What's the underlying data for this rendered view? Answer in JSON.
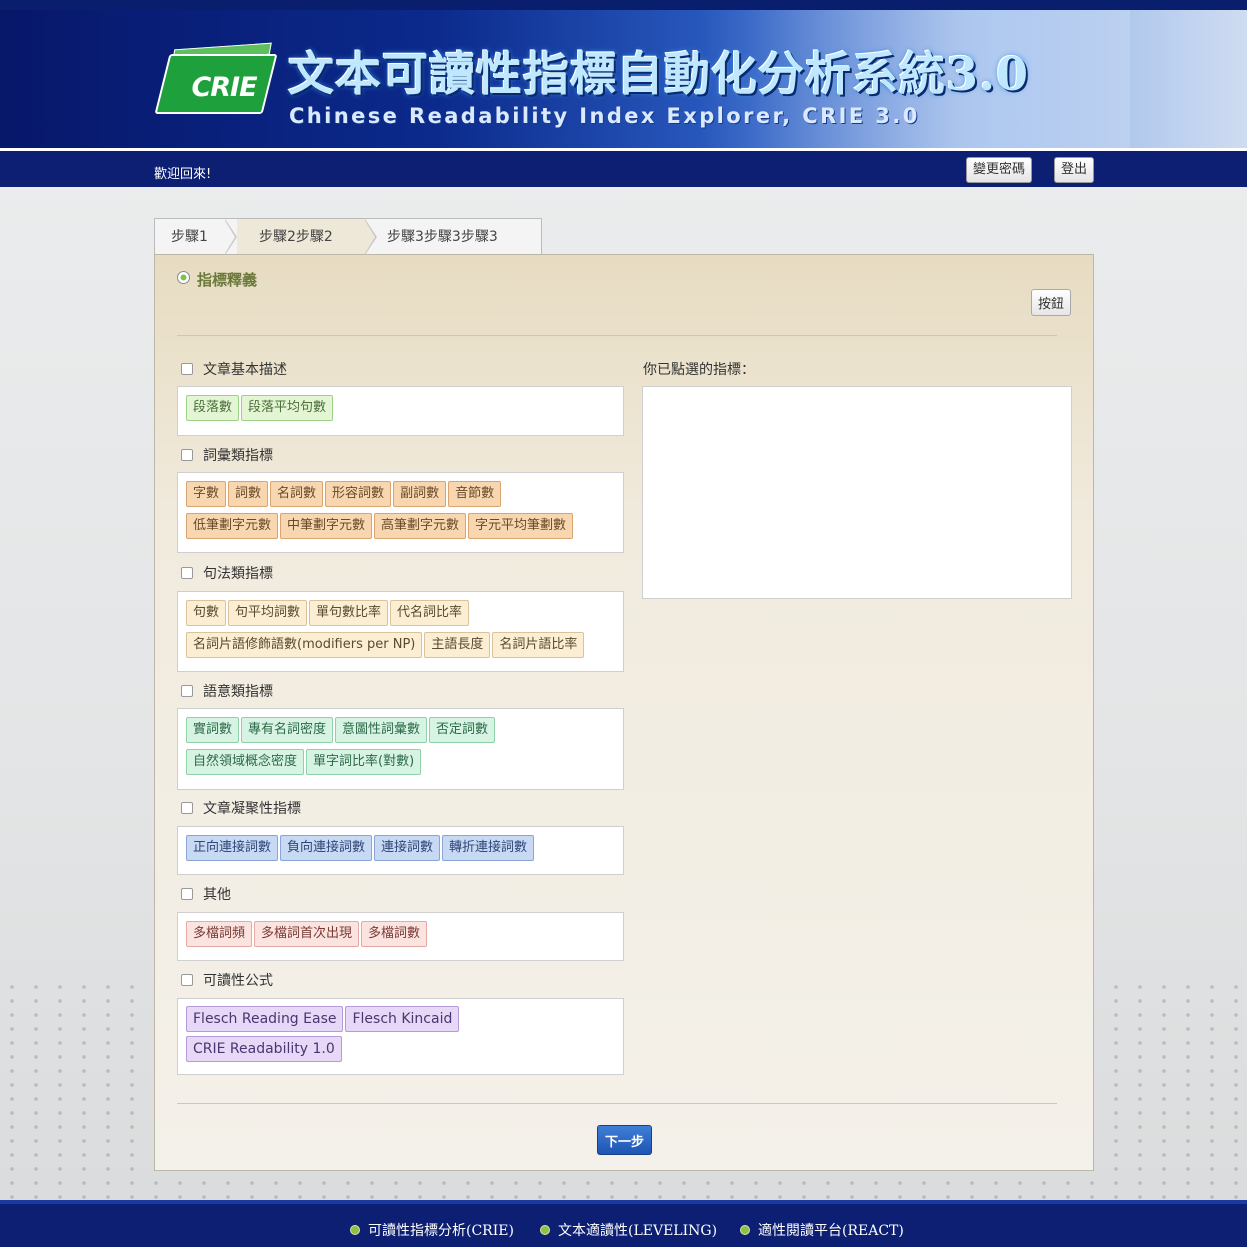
{
  "banner": {
    "logo_text": "CRIE",
    "title_zh": "文本可讀性指標自動化分析系統3.0",
    "title_en": "Chinese Readability Index Explorer, CRIE 3.0"
  },
  "navbar": {
    "welcome": "歡迎回來!",
    "change_password": "變更密碼",
    "logout": "登出"
  },
  "steps": [
    {
      "label": "步驟1"
    },
    {
      "label": "步驟2步驟2"
    },
    {
      "label": "步驟3步驟3步驟3"
    }
  ],
  "panel": {
    "title": "指標釋義",
    "button": "按鈕",
    "selected_label": "你已點選的指標：",
    "next": "下一步"
  },
  "categories": {
    "basic": {
      "title": "文章基本描述",
      "tags": [
        "段落數",
        "段落平均句數"
      ]
    },
    "vocab": {
      "title": "詞彙類指標",
      "tags": [
        "字數",
        "詞數",
        "名詞數",
        "形容詞數",
        "副詞數",
        "音節數",
        "低筆劃字元數",
        "中筆劃字元數",
        "高筆劃字元數",
        "字元平均筆劃數"
      ]
    },
    "syntax": {
      "title": "句法類指標",
      "tags": [
        "句數",
        "句平均詞數",
        "單句數比率",
        "代名詞比率",
        "名詞片語修飾語數(modifiers per NP)",
        "主語長度",
        "名詞片語比率"
      ]
    },
    "semantic": {
      "title": "語意類指標",
      "tags": [
        "實詞數",
        "專有名詞密度",
        "意圖性詞彙數",
        "否定詞數",
        "自然領域概念密度",
        "單字詞比率(對數)"
      ]
    },
    "cohesion": {
      "title": "文章凝聚性指標",
      "tags": [
        "正向連接詞數",
        "負向連接詞數",
        "連接詞數",
        "轉折連接詞數"
      ]
    },
    "other": {
      "title": "其他",
      "tags": [
        "多檔詞頻",
        "多檔詞首次出現",
        "多檔詞數"
      ]
    },
    "formula": {
      "title": "可讀性公式",
      "tags": [
        "Flesch Reading Ease",
        "Flesch Kincaid",
        "CRIE Readability 1.0"
      ]
    }
  },
  "footer": {
    "links": [
      "可讀性指標分析(CRIE)",
      "文本適讀性(LEVELING)",
      "適性閱讀平台(REACT)"
    ]
  },
  "colors": {
    "navy": "#0c1f73",
    "panel_gold": "#e7dcc2",
    "accent_green": "#7dc242",
    "next_blue": "#1e55b2"
  }
}
